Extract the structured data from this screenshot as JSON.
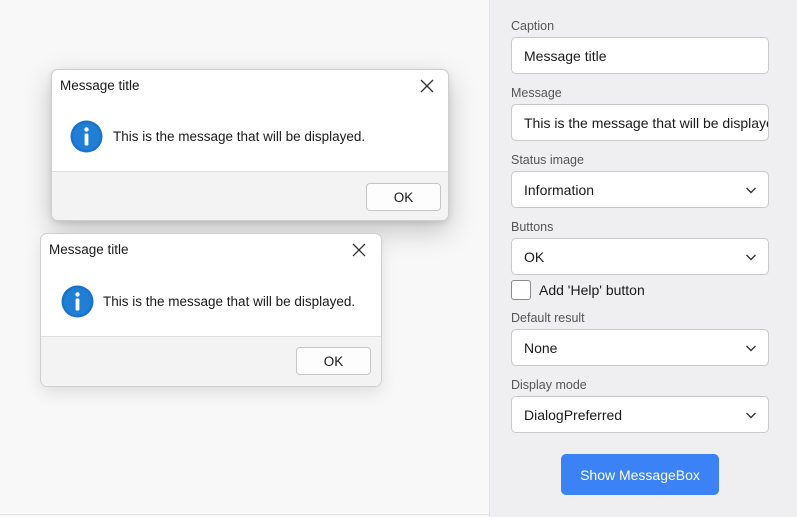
{
  "dialogs": [
    {
      "title": "Message title",
      "message": "This is the message that will be displayed.",
      "icon": "information-icon",
      "ok_label": "OK"
    },
    {
      "title": "Message title",
      "message": "This is the message that will be displayed.",
      "icon": "information-icon",
      "ok_label": "OK"
    }
  ],
  "settings": {
    "caption": {
      "label": "Caption",
      "value": "Message title"
    },
    "message": {
      "label": "Message",
      "value": "This is the message that will be displayed."
    },
    "status_image": {
      "label": "Status image",
      "value": "Information"
    },
    "buttons": {
      "label": "Buttons",
      "value": "OK"
    },
    "help_checkbox": {
      "label": "Add 'Help' button",
      "checked": false
    },
    "default_result": {
      "label": "Default result",
      "value": "None"
    },
    "display_mode": {
      "label": "Display mode",
      "value": "DialogPreferred"
    },
    "show_button_label": "Show MessageBox"
  },
  "colors": {
    "accent": "#3b82f6",
    "info_icon": "#1a73c8",
    "panel_bg": "#efeff1"
  }
}
